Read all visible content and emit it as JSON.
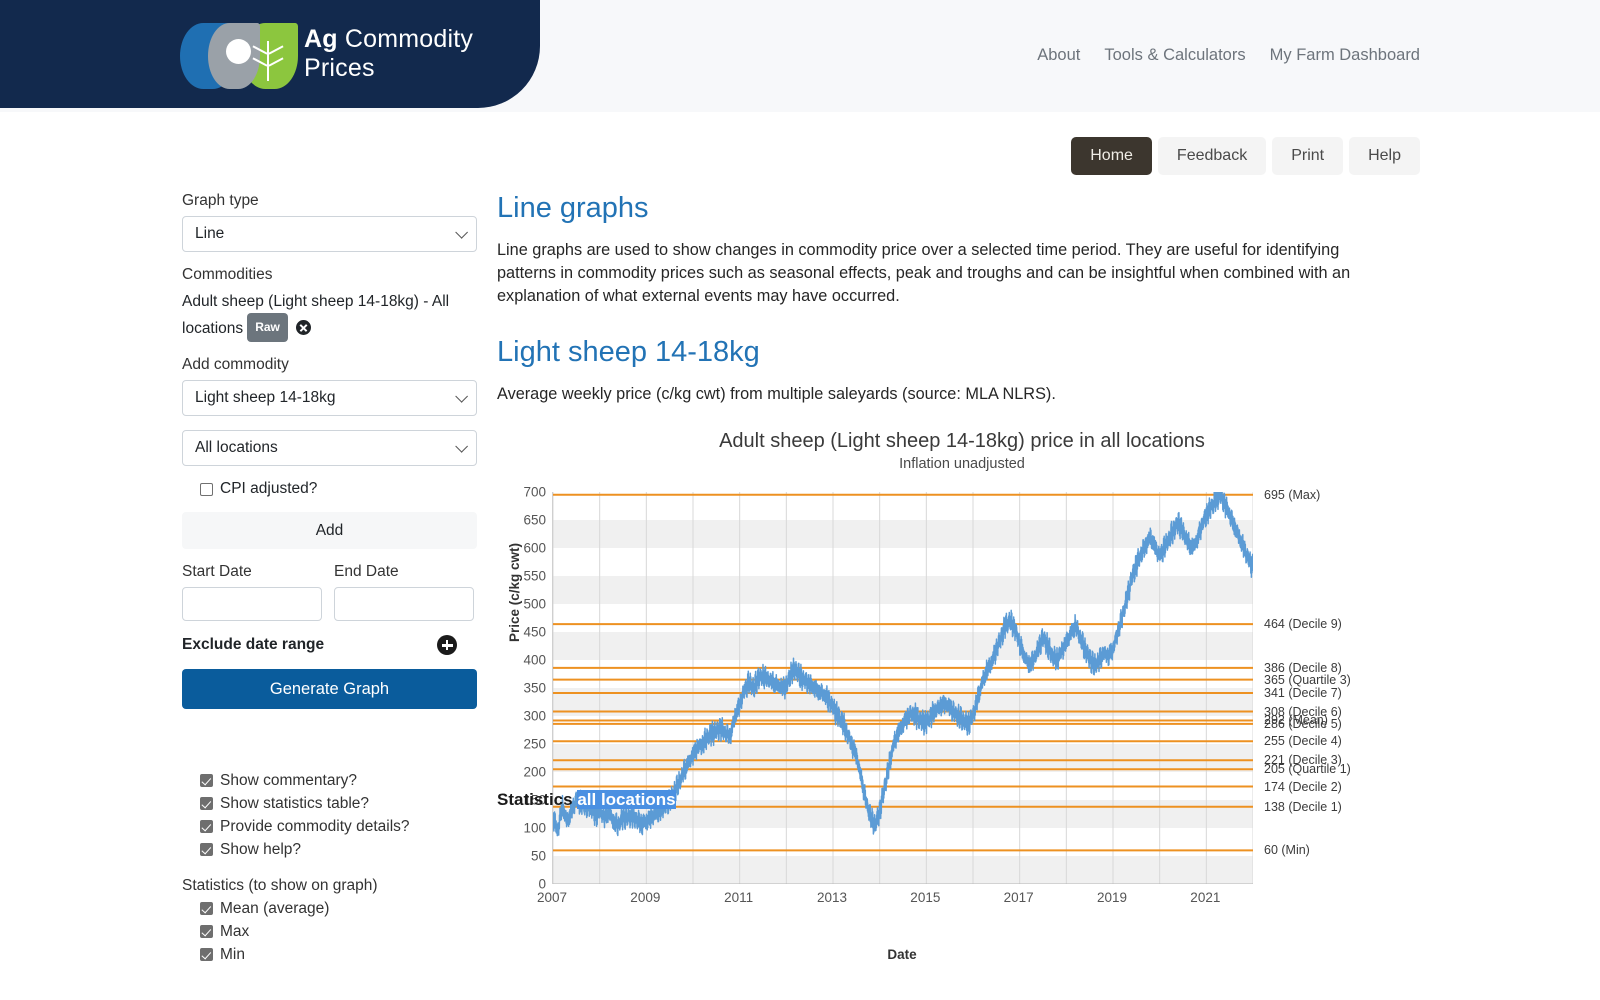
{
  "header": {
    "brand_prefix": "Ag",
    "brand_rest": " Commodity Prices",
    "nav": [
      {
        "label": "About"
      },
      {
        "label": "Tools & Calculators"
      },
      {
        "label": "My Farm Dashboard"
      }
    ]
  },
  "toolbar": {
    "buttons": [
      {
        "label": "Home",
        "active": true
      },
      {
        "label": "Feedback",
        "active": false
      },
      {
        "label": "Print",
        "active": false
      },
      {
        "label": "Help",
        "active": false
      }
    ]
  },
  "sidebar": {
    "graph_type_label": "Graph type",
    "graph_type_value": "Line",
    "commodities_label": "Commodities",
    "commodity_text": "Adult sheep (Light sheep 14-18kg) - All locations",
    "commodity_badge": "Raw",
    "add_commodity_label": "Add commodity",
    "add_commodity_value": "Light sheep 14-18kg",
    "location_value": "All locations",
    "cpi_label": "CPI adjusted?",
    "cpi_checked": false,
    "add_button": "Add",
    "start_date_label": "Start Date",
    "end_date_label": "End Date",
    "start_date_value": "",
    "end_date_value": "",
    "exclude_label": "Exclude date range",
    "generate_button": "Generate Graph",
    "display_options": [
      {
        "label": "Show commentary?",
        "checked": true
      },
      {
        "label": "Show statistics table?",
        "checked": true
      },
      {
        "label": "Provide commodity details?",
        "checked": true
      },
      {
        "label": "Show help?",
        "checked": true
      }
    ],
    "statistics_header": "Statistics (to show on graph)",
    "statistics_options": [
      {
        "label": "Mean (average)",
        "checked": true
      },
      {
        "label": "Max",
        "checked": true
      },
      {
        "label": "Min",
        "checked": true
      }
    ]
  },
  "main": {
    "heading_1": "Line graphs",
    "paragraph_1": "Line graphs are used to show changes in commodity price over a selected time period. They are useful for identifying patterns in commodity prices such as seasonal effects, peak and troughs and can be insightful when combined with an explanation of what external events may have occurred.",
    "heading_2": "Light sheep 14-18kg",
    "paragraph_2": "Average weekly price (c/kg cwt) from multiple saleyards (source: MLA NLRS).",
    "bottom_statistics_label": "Statistics",
    "bottom_statistics_selected": "all locations"
  },
  "chart_data": {
    "type": "line",
    "title": "Adult sheep (Light sheep 14-18kg) price in all locations",
    "subtitle": "Inflation unadjusted",
    "xlabel": "Date",
    "ylabel": "Price (c/kg cwt)",
    "ylim": [
      0,
      700
    ],
    "yticks": [
      0,
      50,
      100,
      150,
      200,
      250,
      300,
      350,
      400,
      450,
      500,
      550,
      600,
      650,
      700
    ],
    "xlim": [
      2007,
      2022
    ],
    "xticks": [
      "2007",
      "2009",
      "2011",
      "2013",
      "2015",
      "2017",
      "2019",
      "2021"
    ],
    "grid": true,
    "legend": "none",
    "series_color": "#5b9bd5",
    "reference_color": "#ed9121",
    "reference_lines": [
      {
        "value": 695,
        "label": "695 (Max)"
      },
      {
        "value": 464,
        "label": "464 (Decile 9)"
      },
      {
        "value": 386,
        "label": "386 (Decile 8)"
      },
      {
        "value": 365,
        "label": "365 (Quartile 3)"
      },
      {
        "value": 341,
        "label": "341 (Decile 7)"
      },
      {
        "value": 308,
        "label": "308 (Decile 6)"
      },
      {
        "value": 292,
        "label": "292 (Mean)"
      },
      {
        "value": 286,
        "label": "286 (Decile 5)"
      },
      {
        "value": 255,
        "label": "255 (Decile 4)"
      },
      {
        "value": 221,
        "label": "221 (Decile 3)"
      },
      {
        "value": 205,
        "label": "205 (Quartile 1)"
      },
      {
        "value": 174,
        "label": "174 (Decile 2)"
      },
      {
        "value": 138,
        "label": "138 (Decile 1)"
      },
      {
        "value": 60,
        "label": "60 (Min)"
      }
    ],
    "series": [
      {
        "name": "Light sheep 14-18kg - All locations",
        "x": [
          2007.0,
          2007.1,
          2007.2,
          2007.3,
          2007.4,
          2007.5,
          2007.6,
          2007.7,
          2007.8,
          2007.9,
          2008.0,
          2008.1,
          2008.2,
          2008.3,
          2008.4,
          2008.5,
          2008.6,
          2008.7,
          2008.8,
          2008.9,
          2009.0,
          2009.1,
          2009.2,
          2009.3,
          2009.4,
          2009.5,
          2009.6,
          2009.7,
          2009.8,
          2009.9,
          2010.0,
          2010.1,
          2010.2,
          2010.3,
          2010.4,
          2010.5,
          2010.6,
          2010.7,
          2010.8,
          2010.9,
          2011.0,
          2011.1,
          2011.2,
          2011.3,
          2011.4,
          2011.5,
          2011.6,
          2011.7,
          2011.8,
          2011.9,
          2012.0,
          2012.1,
          2012.2,
          2012.3,
          2012.4,
          2012.5,
          2012.6,
          2012.7,
          2012.8,
          2012.9,
          2013.0,
          2013.1,
          2013.2,
          2013.3,
          2013.4,
          2013.5,
          2013.6,
          2013.7,
          2013.8,
          2013.9,
          2014.0,
          2014.1,
          2014.2,
          2014.3,
          2014.4,
          2014.5,
          2014.6,
          2014.7,
          2014.8,
          2014.9,
          2015.0,
          2015.1,
          2015.2,
          2015.3,
          2015.4,
          2015.5,
          2015.6,
          2015.7,
          2015.8,
          2015.9,
          2016.0,
          2016.1,
          2016.2,
          2016.3,
          2016.4,
          2016.5,
          2016.6,
          2016.7,
          2016.8,
          2016.9,
          2017.0,
          2017.1,
          2017.2,
          2017.3,
          2017.4,
          2017.5,
          2017.6,
          2017.7,
          2017.8,
          2017.9,
          2018.0,
          2018.1,
          2018.2,
          2018.3,
          2018.4,
          2018.5,
          2018.6,
          2018.7,
          2018.8,
          2018.9,
          2019.0,
          2019.1,
          2019.2,
          2019.3,
          2019.4,
          2019.5,
          2019.6,
          2019.7,
          2019.8,
          2019.9,
          2020.0,
          2020.1,
          2020.2,
          2020.3,
          2020.4,
          2020.5,
          2020.6,
          2020.7,
          2020.8,
          2020.9,
          2021.0,
          2021.1,
          2021.2,
          2021.3,
          2021.4,
          2021.5,
          2021.6,
          2021.7,
          2021.8,
          2021.9,
          2022.0
        ],
        "y": [
          120,
          95,
          140,
          110,
          130,
          150,
          145,
          138,
          142,
          120,
          130,
          118,
          128,
          112,
          105,
          120,
          118,
          122,
          115,
          108,
          112,
          118,
          125,
          130,
          140,
          150,
          165,
          180,
          200,
          215,
          230,
          245,
          250,
          262,
          268,
          272,
          278,
          270,
          265,
          300,
          320,
          345,
          360,
          350,
          368,
          372,
          366,
          360,
          355,
          350,
          352,
          378,
          384,
          370,
          362,
          356,
          350,
          345,
          340,
          330,
          315,
          300,
          290,
          270,
          250,
          230,
          190,
          150,
          120,
          105,
          130,
          170,
          210,
          250,
          270,
          285,
          300,
          305,
          298,
          290,
          288,
          300,
          312,
          318,
          322,
          315,
          305,
          298,
          292,
          286,
          300,
          330,
          360,
          382,
          396,
          420,
          440,
          462,
          470,
          455,
          430,
          408,
          392,
          400,
          420,
          440,
          425,
          408,
          400,
          415,
          430,
          448,
          462,
          440,
          420,
          402,
          390,
          398,
          412,
          408,
          420,
          450,
          478,
          510,
          545,
          570,
          590,
          605,
          620,
          600,
          585,
          600,
          618,
          632,
          645,
          628,
          610,
          600,
          615,
          640,
          660,
          672,
          685,
          695,
          678,
          660,
          640,
          620,
          600,
          580,
          565
        ]
      }
    ]
  }
}
